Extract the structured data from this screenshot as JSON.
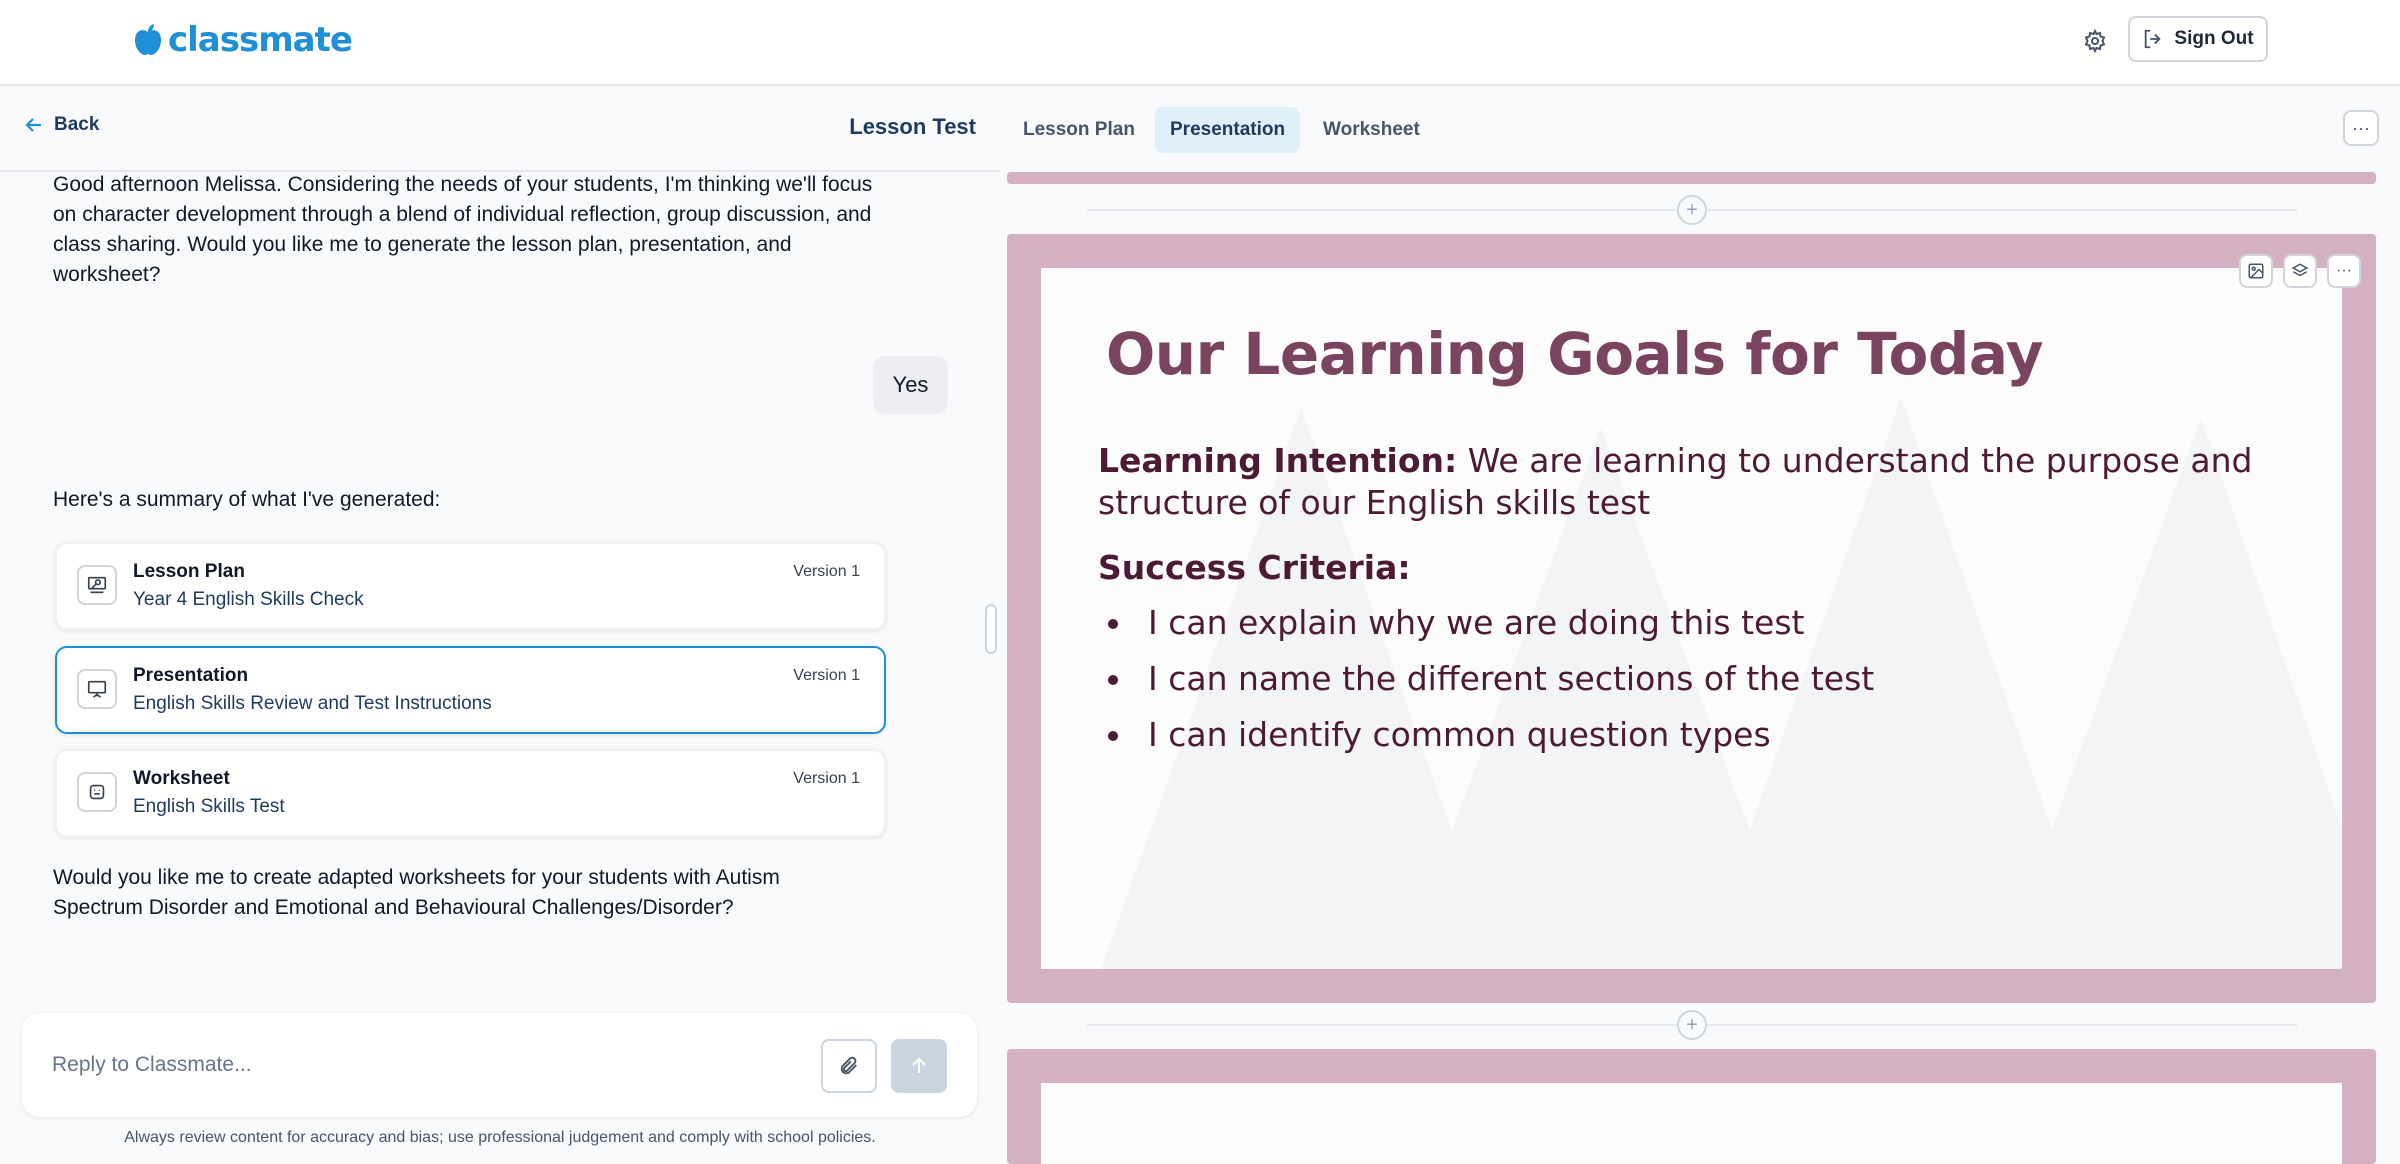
{
  "app": {
    "brand": "classmate",
    "brand_color": "#1f8fd6"
  },
  "header": {
    "sign_out_label": "Sign Out"
  },
  "chat": {
    "back_label": "Back",
    "lesson_title": "Lesson Test",
    "messages": {
      "assistant_1": "Good afternoon Melissa. Considering the needs of your students, I'm thinking we'll focus on character development through a blend of individual reflection, group discussion, and class sharing. Would you like me to generate the lesson plan, presentation, and worksheet?",
      "user_1": "Yes",
      "assistant_2": "Here's a summary of what I've generated:",
      "assistant_3": "Would you like me to create adapted worksheets for your students with Autism Spectrum Disorder and Emotional and Behavioural Challenges/Disorder?"
    },
    "cards": [
      {
        "title": "Lesson Plan",
        "subtitle": "Year 4 English Skills Check",
        "version": "Version 1",
        "icon": "lesson-plan-icon"
      },
      {
        "title": "Presentation",
        "subtitle": "English Skills Review and Test Instructions",
        "version": "Version 1",
        "icon": "presentation-icon",
        "active": true
      },
      {
        "title": "Worksheet",
        "subtitle": "English Skills Test",
        "version": "Version 1",
        "icon": "worksheet-icon"
      }
    ],
    "reply_placeholder": "Reply to Classmate...",
    "disclaimer": "Always review content for accuracy and bias; use professional judgement and comply with school policies."
  },
  "tabs": [
    {
      "label": "Lesson Plan"
    },
    {
      "label": "Presentation",
      "active": true
    },
    {
      "label": "Worksheet"
    }
  ],
  "slide": {
    "title": "Our Learning Goals for Today",
    "learning_intention_label": "Learning Intention:",
    "learning_intention_text": " We are learning to understand the purpose and structure of our English skills test",
    "success_criteria_label": "Success Criteria:",
    "criteria": [
      "I can explain why we are doing this test",
      "I can name the different sections of the test",
      "I can identify common question types"
    ],
    "frame_color": "#d3b1c2",
    "text_color": "#4d1a36"
  }
}
